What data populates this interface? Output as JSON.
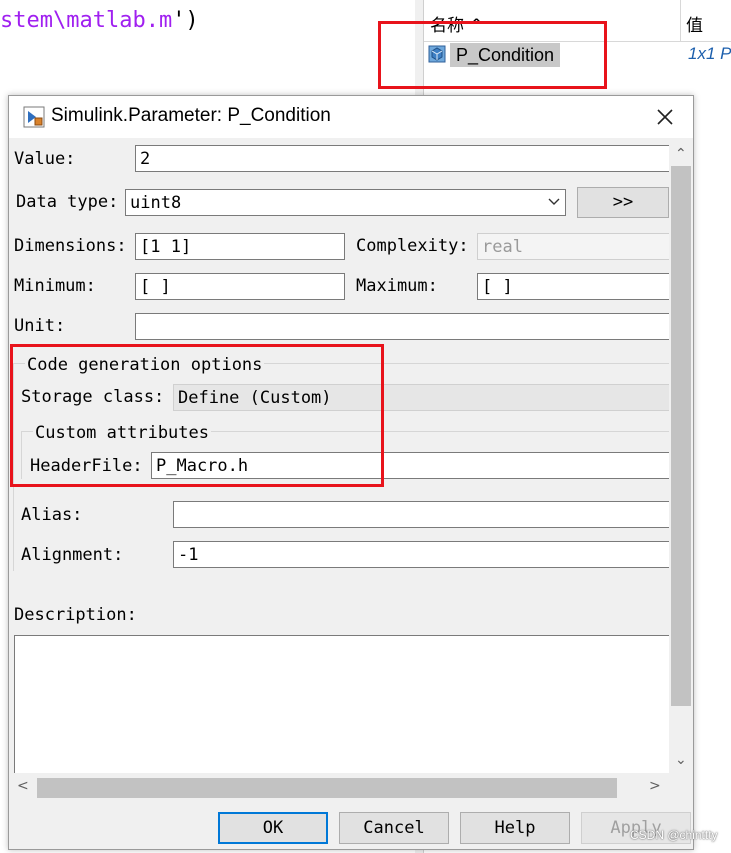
{
  "editor": {
    "code_fragment": "stem\\matlab.m",
    "code_suffix": "')"
  },
  "workspace": {
    "col_name": "名称 ^",
    "col_value": "值",
    "row": {
      "name": "P_Condition",
      "value": "1x1 P"
    }
  },
  "dialog": {
    "title": "Simulink.Parameter: P_Condition",
    "fields": {
      "value_label": "Value:",
      "value": "2",
      "datatype_label": "Data type:",
      "datatype": "uint8",
      "datatype_assist": ">>",
      "dimensions_label": "Dimensions:",
      "dimensions": "[1 1]",
      "complexity_label": "Complexity:",
      "complexity": "real",
      "minimum_label": "Minimum:",
      "minimum": "[ ]",
      "maximum_label": "Maximum:",
      "maximum": "[ ]",
      "unit_label": "Unit:",
      "unit": ""
    },
    "codegen": {
      "group_label": "Code generation options",
      "storage_class_label": "Storage class:",
      "storage_class": "Define (Custom)",
      "custom_attrs_label": "Custom attributes",
      "headerfile_label": "HeaderFile:",
      "headerfile": "P_Macro.h",
      "alias_label": "Alias:",
      "alias": "",
      "alignment_label": "Alignment:",
      "alignment": "-1"
    },
    "description_label": "Description:",
    "description": "",
    "buttons": {
      "ok": "OK",
      "cancel": "Cancel",
      "help": "Help",
      "apply": "Apply"
    }
  },
  "watermark": "CSDN @chinttty",
  "colors": {
    "highlight_box": "#e8131b",
    "editor_string": "#a020f0",
    "ws_value": "#1c5fad"
  }
}
